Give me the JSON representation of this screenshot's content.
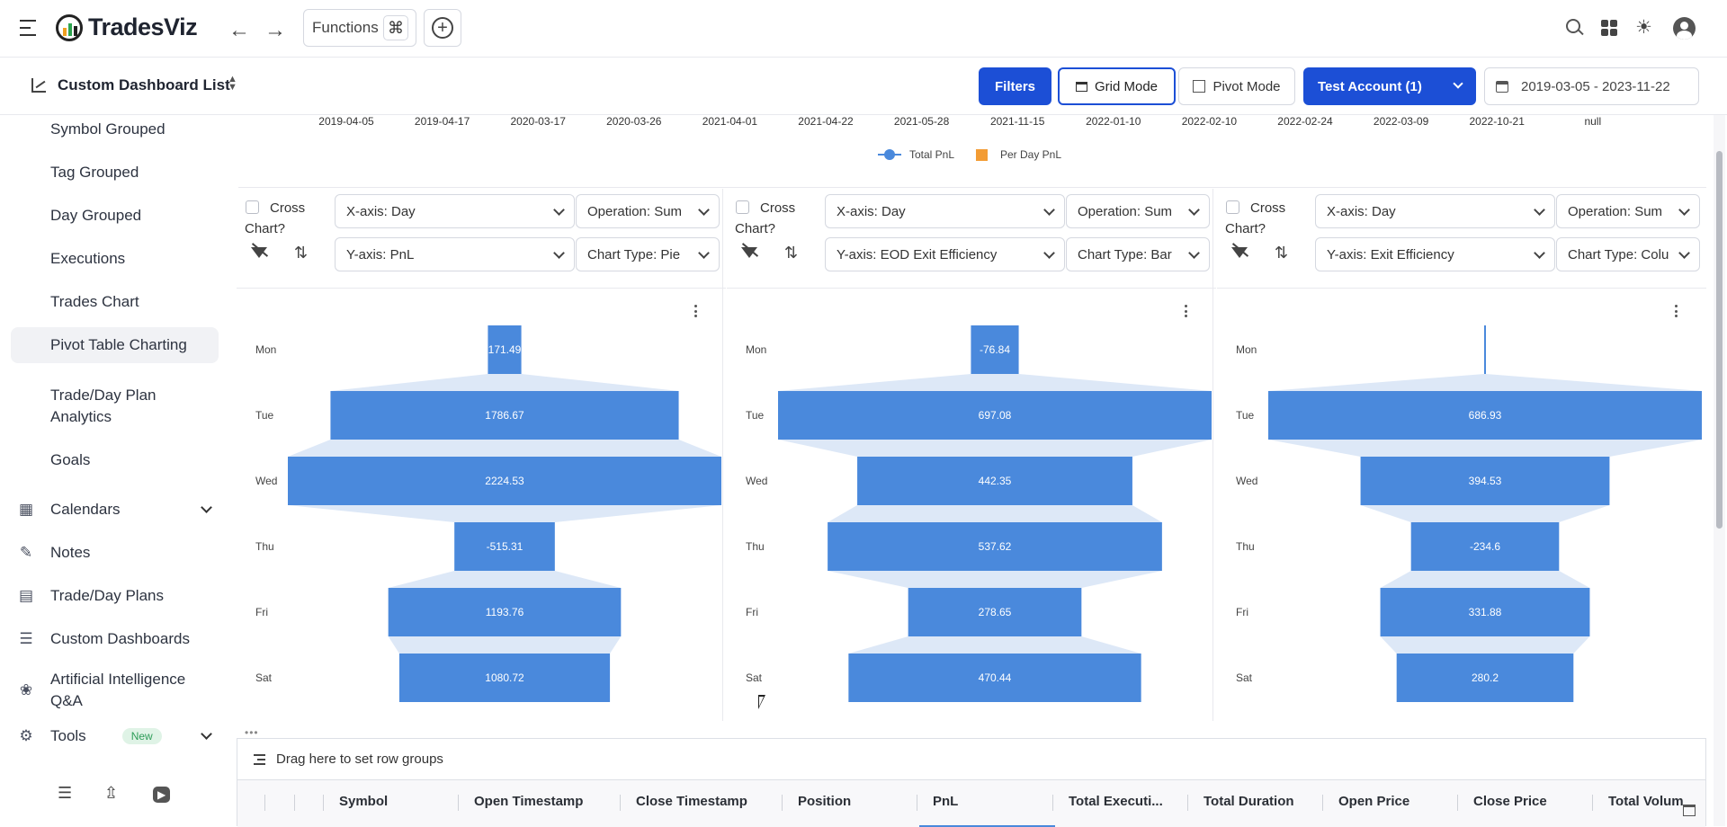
{
  "app": {
    "name": "TradesViz"
  },
  "topbar": {
    "functions_label": "Functions"
  },
  "subbar": {
    "title": "Custom Dashboard List",
    "filters_label": "Filters",
    "grid_mode_label": "Grid Mode",
    "pivot_mode_label": "Pivot Mode",
    "account_label": "Test Account (1)",
    "date_range": "2019-03-05 - 2023-11-22"
  },
  "sidebar": {
    "items": [
      {
        "label": "Symbol Grouped"
      },
      {
        "label": "Tag Grouped"
      },
      {
        "label": "Day Grouped"
      },
      {
        "label": "Executions"
      },
      {
        "label": "Trades Chart"
      },
      {
        "label": "Pivot Table Charting",
        "active": true
      },
      {
        "label": "Trade/Day Plan Analytics"
      },
      {
        "label": "Goals"
      }
    ],
    "groups": [
      {
        "label": "Calendars"
      },
      {
        "label": "Notes"
      },
      {
        "label": "Trade/Day Plans"
      },
      {
        "label": "Custom Dashboards"
      },
      {
        "label": "Artificial Intelligence Q&A"
      },
      {
        "label": "Tools",
        "badge": "New"
      }
    ]
  },
  "top_chart": {
    "x_ticks": [
      "2019-04-05",
      "2019-04-17",
      "2020-03-17",
      "2020-03-26",
      "2021-04-01",
      "2021-04-22",
      "2021-05-28",
      "2021-11-15",
      "2022-01-10",
      "2022-02-10",
      "2022-02-24",
      "2022-03-09",
      "2022-10-21",
      "null"
    ],
    "legend": [
      {
        "name": "Total PnL",
        "color": "#4a89dc"
      },
      {
        "name": "Per Day PnL",
        "color": "#f39c34"
      }
    ]
  },
  "panels": [
    {
      "cross_chart_label": "Cross Chart?",
      "x_axis": "X-axis: Day",
      "operation": "Operation: Sum",
      "y_axis": "Y-axis: PnL",
      "chart_type": "Chart Type: Pie"
    },
    {
      "cross_chart_label": "Cross Chart?",
      "x_axis": "X-axis: Day",
      "operation": "Operation: Sum",
      "y_axis": "Y-axis: EOD Exit Efficiency",
      "chart_type": "Chart Type: Bar"
    },
    {
      "cross_chart_label": "Cross Chart?",
      "x_axis": "X-axis: Day",
      "operation": "Operation: Sum",
      "y_axis": "Y-axis: Exit Efficiency",
      "chart_type": "Chart Type: Colu"
    }
  ],
  "chart_data": [
    {
      "type": "bar",
      "categories": [
        "Mon",
        "Tue",
        "Wed",
        "Thu",
        "Fri",
        "Sat"
      ],
      "values": [
        171.49,
        1786.67,
        2224.53,
        -515.31,
        1193.76,
        1080.72
      ],
      "value_labels": [
        "171.49",
        "1786.67",
        "2224.53",
        "-515.31",
        "1193.76",
        "1080.72"
      ],
      "color": "#4a89dc"
    },
    {
      "type": "bar",
      "categories": [
        "Mon",
        "Tue",
        "Wed",
        "Thu",
        "Fri",
        "Sat"
      ],
      "values": [
        -76.84,
        697.08,
        442.35,
        537.62,
        278.65,
        470.44
      ],
      "value_labels": [
        "-76.84",
        "697.08",
        "442.35",
        "537.62",
        "278.65",
        "470.44"
      ],
      "color": "#4a89dc"
    },
    {
      "type": "bar",
      "categories": [
        "Mon",
        "Tue",
        "Wed",
        "Thu",
        "Fri",
        "Sat"
      ],
      "values": [
        0,
        686.93,
        394.53,
        -234.6,
        331.88,
        280.2
      ],
      "value_labels": [
        "",
        "686.93",
        "394.53",
        "-234.6",
        "331.88",
        "280.2"
      ],
      "color": "#4a89dc"
    }
  ],
  "grid": {
    "drag_hint": "Drag here to set row groups",
    "columns": [
      "Symbol",
      "Open Timestamp",
      "Close Timestamp",
      "Position",
      "PnL",
      "Total Executi...",
      "Total Duration",
      "Open Price",
      "Close Price",
      "Total Volum"
    ]
  }
}
